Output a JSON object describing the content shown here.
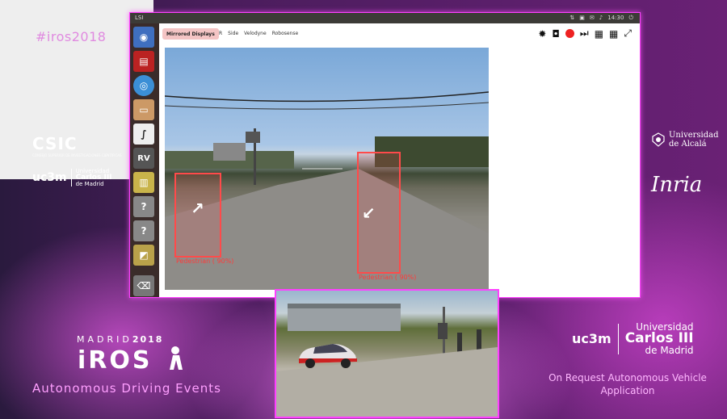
{
  "conference": {
    "hashtag": "#iros2018",
    "city_label": "MADRID",
    "year_label": "2018",
    "logo_text": "iROS",
    "event_title": "Autonomous Driving Events"
  },
  "sponsors": {
    "csic": "CSIC",
    "csic_subtitle": "CONSEJO SUPERIOR DE INVESTIGACIONES CIENTÍFICAS",
    "uc3m": "uc3m",
    "universidad": "Universidad",
    "carlos": "Carlos III",
    "de_madrid": "de Madrid",
    "alcala_line1": "Universidad",
    "alcala_line2": "de Alcalá",
    "inria": "Inria"
  },
  "right_caption": "On Request Autonomous Vehicle Application",
  "screen": {
    "topbar_app": "LSI",
    "clock": "14:30",
    "toolbar": {
      "mirrored_button": "Mirrored Displays",
      "tabs": [
        "R",
        "Side",
        "Velodyne",
        "Robosense"
      ],
      "icons": [
        "bug-icon",
        "camera-icon",
        "record-icon",
        "play-next-icon",
        "grid-icon",
        "grid-alt-icon",
        "fullscreen-icon"
      ]
    },
    "launcher_icons": [
      "dash-icon",
      "terminal-icon",
      "chromium-icon",
      "files-icon",
      "text-editor-icon",
      "rviz-icon",
      "archive-icon",
      "unknown-app-icon",
      "unknown-app-icon",
      "monitor-icon",
      "trash-icon"
    ],
    "launcher_rviz_label": "RV",
    "detections": [
      {
        "label": "Pedestrian ( 90%)",
        "direction": "↗"
      },
      {
        "label": "Pedestrian ( 90%)",
        "direction": "↙"
      }
    ]
  },
  "colors": {
    "accent_magenta": "#ff40ff",
    "bbox_red": "#ff4a4a",
    "record_red": "#e22222"
  }
}
